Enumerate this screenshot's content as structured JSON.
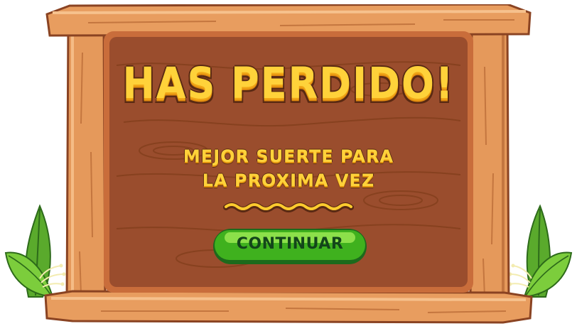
{
  "dialog": {
    "title": "HAS PERDIDO!",
    "message_line1": "MEJOR SUERTE PARA",
    "message_line2": "LA PROXIMA VEZ"
  },
  "buttons": {
    "continue_label": "CONTINUAR"
  },
  "colors": {
    "title_yellow": "#ffd23a",
    "wood_light": "#e69a5e",
    "wood_panel": "#9a4d2d",
    "button_green": "#3fb11e",
    "leaf_green": "#6cc03a"
  },
  "icons": {
    "left_decoration": "palm-leaves-icon",
    "right_decoration": "palm-leaves-icon",
    "divider": "wavy-line-icon"
  }
}
